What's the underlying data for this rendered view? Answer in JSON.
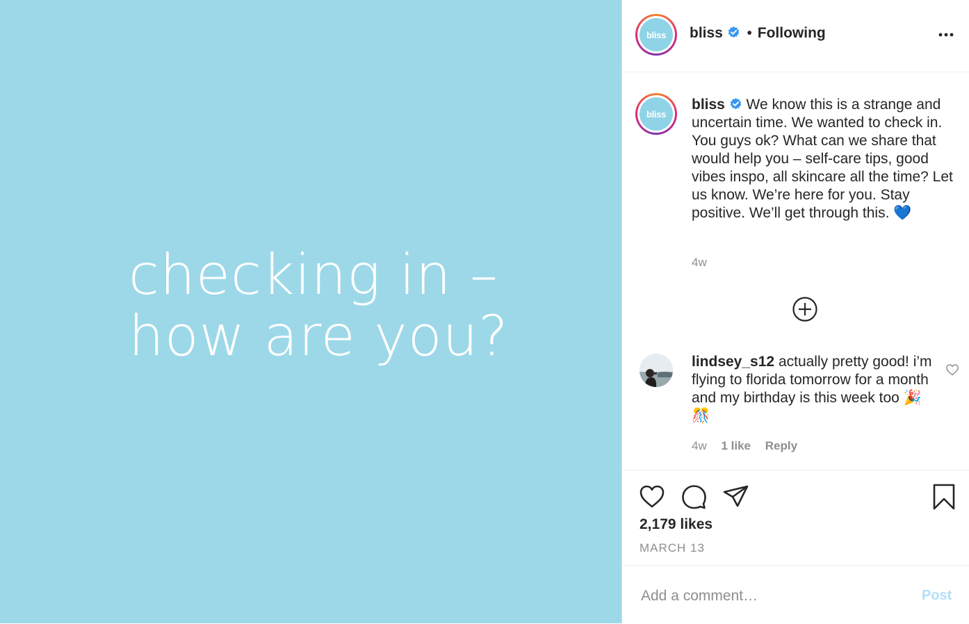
{
  "media": {
    "line1": "checking in –",
    "line2": "how are you?",
    "background_color": "#9dd8e8"
  },
  "header": {
    "username": "bliss",
    "avatar_text": "bliss",
    "separator": "•",
    "follow_status": "Following",
    "more_icon": "more-options-icon"
  },
  "caption": {
    "username": "bliss",
    "text": "We know this is a strange and uncertain time. We wanted to check in. You guys ok? What can we share that would help you – self-care tips, good vibes inspo, all skincare all the time? Let us know. We’re here for you. Stay positive. We’ll get through this. 💙",
    "time": "4w"
  },
  "comments": [
    {
      "username": "lindsey_s12",
      "text": "actually pretty good! i’m flying to florida tomorrow for a month and my birthday is this week too 🎉🎊",
      "time": "4w",
      "likes": "1 like",
      "reply": "Reply"
    }
  ],
  "actions": {
    "likes": "2,179 likes",
    "date": "MARCH 13"
  },
  "add_comment": {
    "placeholder": "Add a comment…",
    "post_label": "Post"
  },
  "colors": {
    "verified": "#3897f0",
    "post_disabled": "#b2dffc",
    "muted": "#8e8e8e"
  }
}
